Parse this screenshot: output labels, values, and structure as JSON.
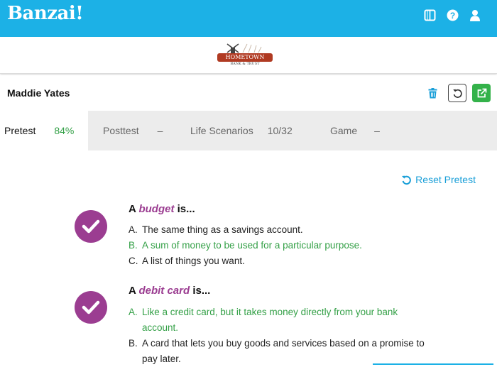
{
  "app": {
    "brand": "Banzai!"
  },
  "header_icons": [
    "book-icon",
    "help-icon",
    "user-icon"
  ],
  "bank": {
    "name": "HOMETOWN",
    "sub": "BANK & TRUST"
  },
  "user": {
    "name": "Maddie Yates"
  },
  "tabs": [
    {
      "label": "Pretest",
      "score": "84%"
    },
    {
      "label": "Posttest",
      "score": "–"
    },
    {
      "label": "Life Scenarios",
      "score": "10/32"
    },
    {
      "label": "Game",
      "score": "–"
    }
  ],
  "reset": {
    "label": "Reset Pretest"
  },
  "questions": [
    {
      "prefix": "A",
      "term": "budget",
      "suffix": "is...",
      "options": [
        {
          "letter": "A.",
          "text": "The same thing as a savings account."
        },
        {
          "letter": "B.",
          "text": "A sum of money to be used for a particular purpose."
        },
        {
          "letter": "C.",
          "text": "A list of things you want."
        }
      ]
    },
    {
      "prefix": "A",
      "term": "debit card",
      "suffix": "is...",
      "options": [
        {
          "letter": "A.",
          "text": "Like a credit card, but it takes money directly from your bank",
          "text2": "account."
        },
        {
          "letter": "B.",
          "text": "A card that lets you buy goods and services based on a promise to",
          "text2": "pay later."
        }
      ]
    }
  ],
  "colors": {
    "header": "#1cb1e6",
    "correct": "#34a047",
    "accent": "#9b3d91",
    "link": "#1a9fd8",
    "open_button": "#34b24a"
  }
}
